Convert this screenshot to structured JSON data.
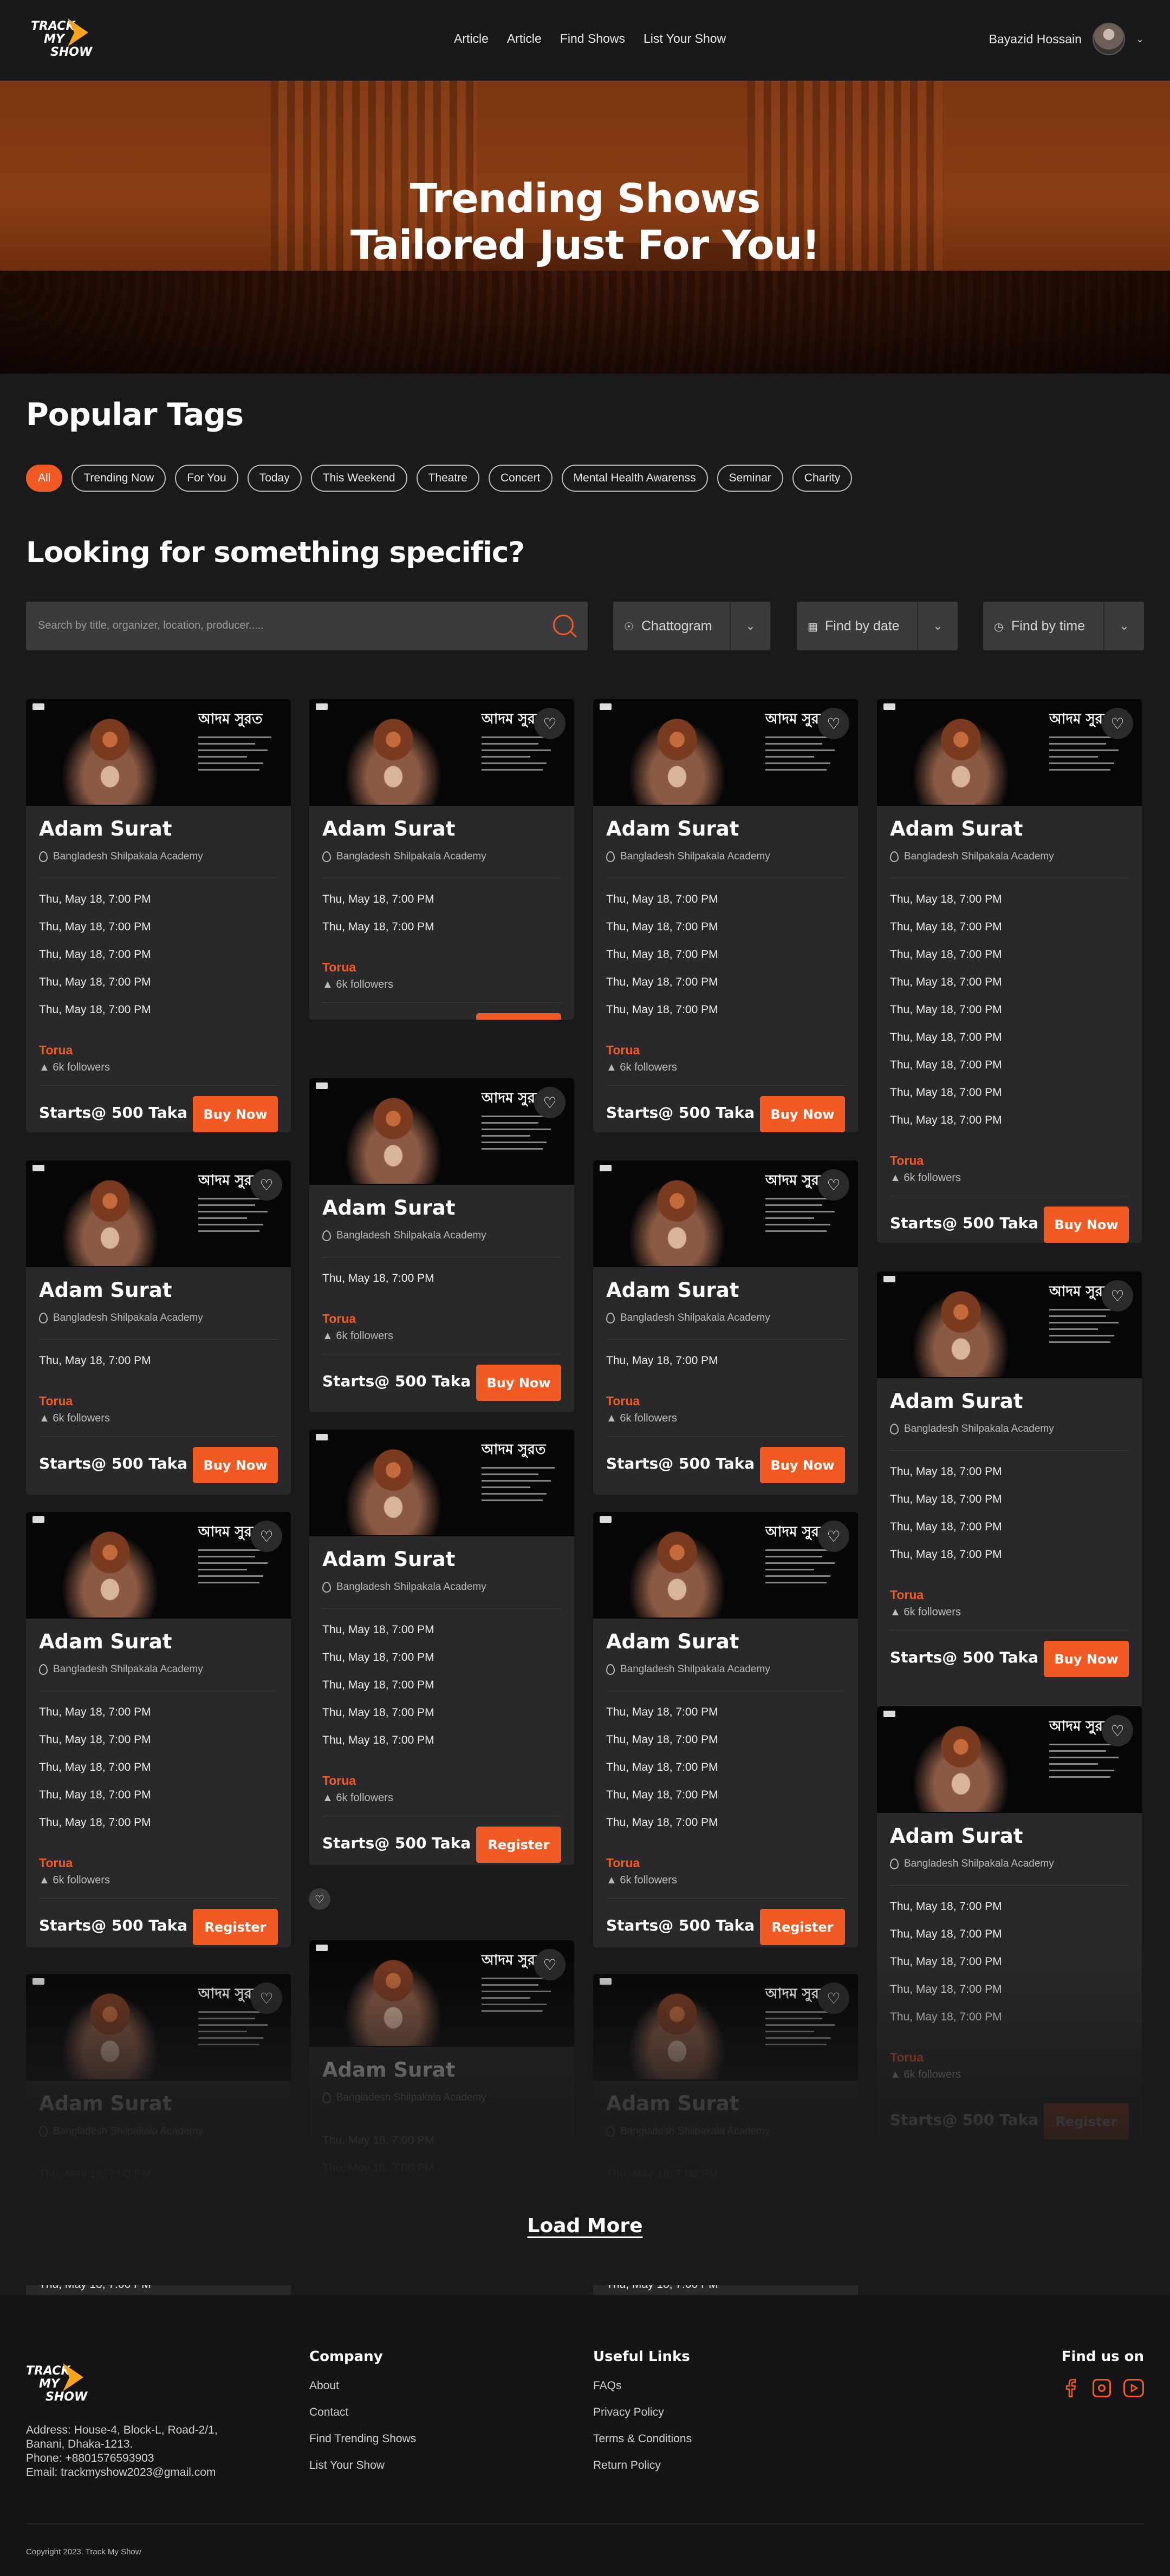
{
  "nav": {
    "logo_top": "TRACK",
    "logo_mid": "MY",
    "logo_bot": "SHOW",
    "links": [
      "Article",
      "Article",
      "Find Shows",
      "List Your Show"
    ],
    "user_name": "Bayazid Hossain"
  },
  "hero": {
    "line1": "Trending Shows",
    "line2": "Tailored Just For You!"
  },
  "tags_section": {
    "title": "Popular Tags",
    "tags": [
      "All",
      "Trending Now",
      "For You",
      "Today",
      "This Weekend",
      "Theatre",
      "Concert",
      "Mental Health Awarenss",
      "Seminar",
      "Charity"
    ],
    "active": "All"
  },
  "search_section": {
    "title": "Looking for something specific?",
    "placeholder": "Search by title, organizer, location, producer.....",
    "location": "Chattogram",
    "date": "Find by date",
    "time": "Find by time"
  },
  "card_common": {
    "title": "Adam Surat",
    "venue": "Bangladesh Shilpakala Academy",
    "date": "Thu, May 18, 7:00 PM",
    "organizer": "Torua",
    "followers": "6k followers",
    "price": "Starts@ 500 Taka",
    "poster_title": "আদম সুরত"
  },
  "cards": [
    {
      "dates": 5,
      "button": "Buy Now"
    },
    {
      "dates": 2,
      "button": "Buy Now"
    },
    {
      "dates": 5,
      "button": "Buy Now"
    },
    {
      "dates": 9,
      "button": "Buy Now"
    },
    {
      "dates": 1,
      "button": "Buy Now"
    },
    {
      "dates": 1,
      "button": "Buy Now"
    },
    {
      "dates": 1,
      "button": "Buy Now"
    },
    {
      "dates": 4,
      "button": "Buy Now"
    },
    {
      "dates": 5,
      "button": "Register"
    },
    {
      "dates": 5,
      "button": "Register"
    },
    {
      "dates": 5,
      "button": "Register"
    },
    {
      "dates": 5,
      "button": "Register"
    }
  ],
  "load_more": "Load More",
  "footer": {
    "address": "Address: House-4, Block-L, Road-2/1, Banani, Dhaka-1213.",
    "phone": "Phone:  +8801576593903",
    "email": "Email:  trackmyshow2023@gmail.com",
    "company_title": "Company",
    "company_links": [
      "About",
      "Contact",
      "Find Trending Shows",
      "List Your Show"
    ],
    "useful_title": "Useful Links",
    "useful_links": [
      "FAQs",
      "Privacy Policy",
      "Terms & Conditions",
      "Return Policy"
    ],
    "find_us": "Find us on",
    "social": [
      "facebook-icon",
      "instagram-icon",
      "youtube-icon"
    ],
    "copyright": "Copyright 2023. Track My Show"
  },
  "colors": {
    "accent": "#f15a22",
    "bg": "#1a1a1c",
    "card": "#29292b"
  }
}
